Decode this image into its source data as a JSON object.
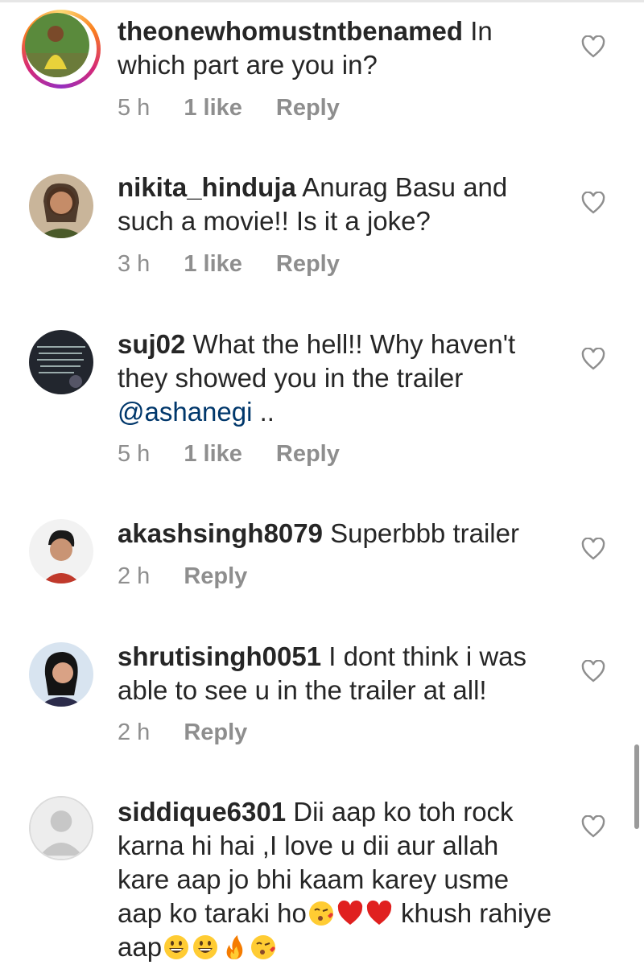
{
  "comments": [
    {
      "username": "theonewhomustntbenamed",
      "text": " In which part are you in?",
      "time": "5 h",
      "likes": "1 like",
      "reply": "Reply"
    },
    {
      "username": "nikita_hinduja",
      "text": " Anurag Basu and such a movie!! Is it a joke?",
      "time": "3 h",
      "likes": "1 like",
      "reply": "Reply"
    },
    {
      "username": "suj02",
      "text": " What the hell!! Why haven't they showed you in the trailer ",
      "mention": "@ashanegi",
      "text_after": " ..",
      "time": "5 h",
      "likes": "1 like",
      "reply": "Reply"
    },
    {
      "username": "akashsingh8079",
      "text": " Superbbb trailer",
      "time": "2 h",
      "reply": "Reply"
    },
    {
      "username": "shrutisingh0051",
      "text": " I dont think i was able to see u in the trailer at all!",
      "time": "2 h",
      "reply": "Reply"
    },
    {
      "username": "siddique6301",
      "text": " Dii aap ko toh rock karna hi hai ,I love u dii aur allah kare aap jo  bhi kaam karey usme aap ko taraki ho",
      "text_mid": " khush rahiye aap",
      "emoji_a": [
        "kiss-face",
        "red-heart",
        "red-heart"
      ],
      "emoji_b": [
        "grinning-face",
        "grinning-face",
        "fire",
        "kiss-face"
      ]
    }
  ],
  "colors": {
    "text": "#262626",
    "meta": "#8e8e8e",
    "mention": "#00376b",
    "heart": "#8e8e8e"
  }
}
